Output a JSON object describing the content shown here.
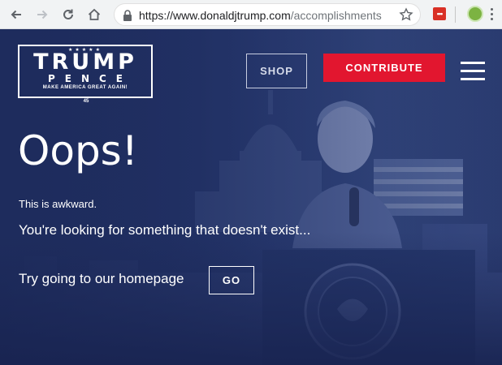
{
  "browser": {
    "url_host": "https://www.donaldjtrump.com",
    "url_path": "/accomplishments"
  },
  "logo": {
    "stars": "★★★★★",
    "line1": "TRUMP",
    "line2": "PENCE",
    "slogan": "MAKE AMERICA GREAT AGAIN!",
    "number": "45"
  },
  "nav": {
    "shop_label": "SHOP",
    "contribute_label": "CONTRIBUTE"
  },
  "main": {
    "heading": "Oops!",
    "subtext": "This is awkward.",
    "message": "You're looking for something that doesn't exist...",
    "homepage_prompt": "Try going to our homepage",
    "go_label": "GO"
  },
  "colors": {
    "contribute_bg": "#e2162f",
    "hero_bg": "#1e2c5d"
  }
}
